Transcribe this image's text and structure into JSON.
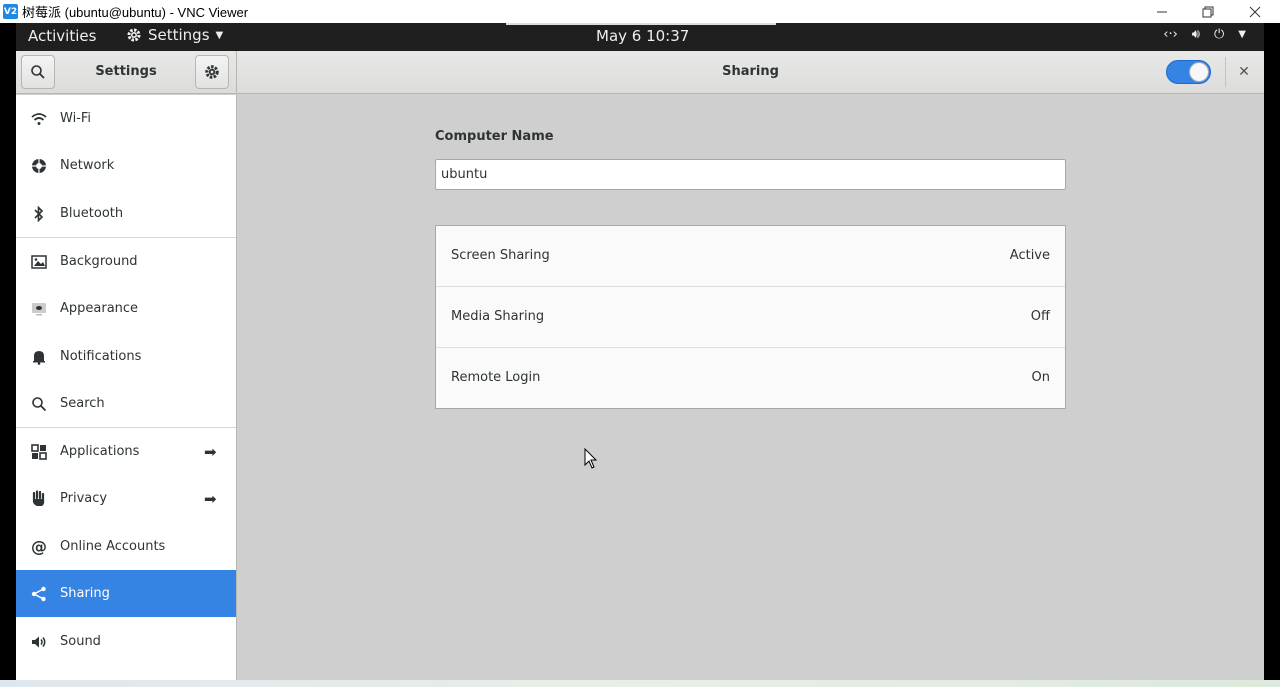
{
  "vnc": {
    "logo_text": "V2",
    "title": "树莓派 (ubuntu@ubuntu) - VNC Viewer"
  },
  "topbar": {
    "activities": "Activities",
    "app_menu": "Settings",
    "clock": "May 6  10:37"
  },
  "header": {
    "left_title": "Settings",
    "title": "Sharing",
    "sharing_toggle": "on"
  },
  "sidebar": {
    "items": [
      {
        "label": "Wi-Fi",
        "icon": "wifi-icon"
      },
      {
        "label": "Network",
        "icon": "network-icon"
      },
      {
        "label": "Bluetooth",
        "icon": "bluetooth-icon"
      },
      {
        "label": "Background",
        "icon": "background-icon"
      },
      {
        "label": "Appearance",
        "icon": "appearance-icon"
      },
      {
        "label": "Notifications",
        "icon": "bell-icon"
      },
      {
        "label": "Search",
        "icon": "search-icon"
      },
      {
        "label": "Applications",
        "icon": "apps-icon"
      },
      {
        "label": "Privacy",
        "icon": "hand-icon"
      },
      {
        "label": "Online Accounts",
        "icon": "at-icon"
      },
      {
        "label": "Sharing",
        "icon": "share-icon"
      },
      {
        "label": "Sound",
        "icon": "speaker-icon"
      }
    ]
  },
  "main": {
    "computer_name_label": "Computer Name",
    "computer_name_value": "ubuntu",
    "rows": [
      {
        "label": "Screen Sharing",
        "value": "Active"
      },
      {
        "label": "Media Sharing",
        "value": "Off"
      },
      {
        "label": "Remote Login",
        "value": "On"
      }
    ]
  },
  "colors": {
    "accent": "#3584e4",
    "topbar": "#1f1f1f",
    "content_bg": "#cfcfcf"
  }
}
